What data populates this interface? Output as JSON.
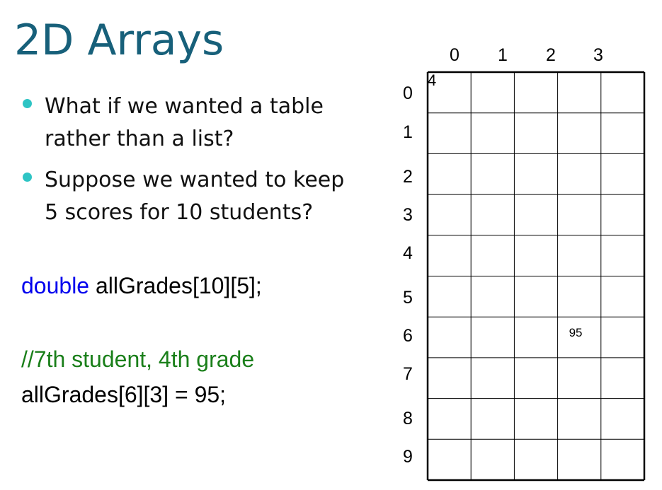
{
  "slide": {
    "title": "2D Arrays",
    "bullets": [
      {
        "line1": "What if we wanted a table",
        "line2": "rather than a list?"
      },
      {
        "line1": "Suppose we wanted to keep",
        "line2": "5 scores for 10 students?"
      }
    ],
    "declaration": {
      "keyword": "double",
      "rest": " allGrades[10][5];"
    },
    "comment": "//7th student, 4th grade",
    "assignment": "allGrades[6][3] = 95;"
  },
  "table": {
    "col_labels": [
      "0",
      "1",
      "2",
      "3"
    ],
    "row_labels": [
      "0",
      "1",
      "2",
      "3",
      "4",
      "5",
      "6",
      "7",
      "8",
      "9"
    ],
    "corner_label": "4",
    "cell_value": "95",
    "cell_row": 6,
    "cell_col": 3,
    "rows": 10,
    "cols": 5
  },
  "colors": {
    "title": "#17607a",
    "bullet_dot": "#2ec4c4",
    "keyword": "#0000ee",
    "comment": "#1a7f1a"
  }
}
